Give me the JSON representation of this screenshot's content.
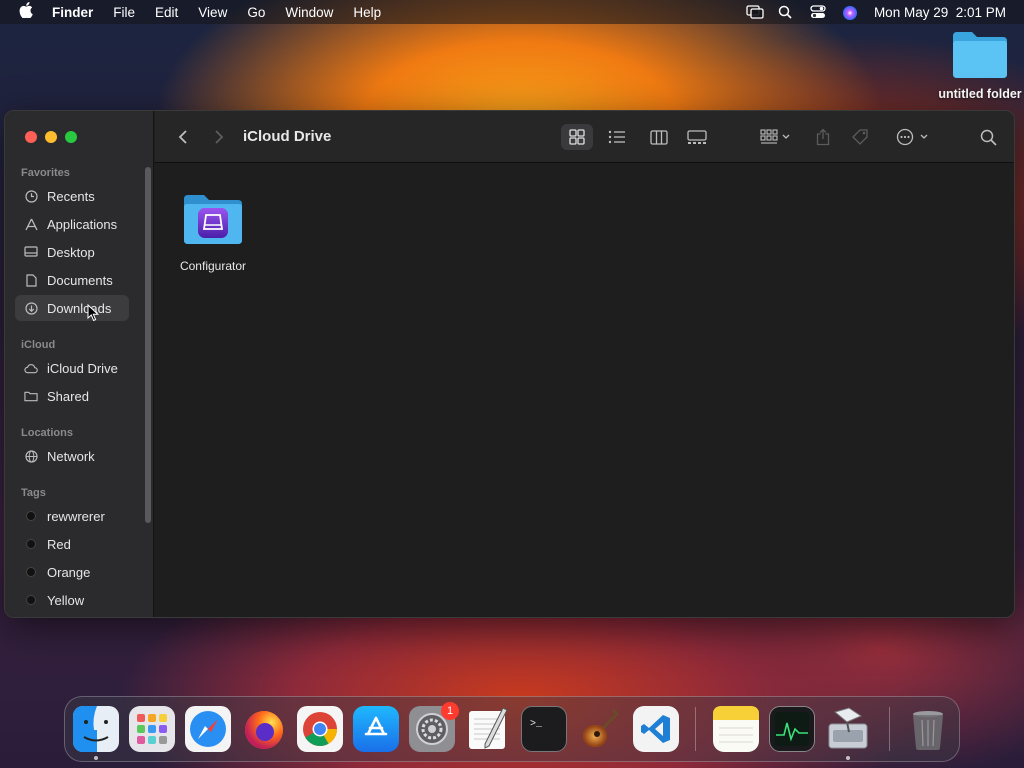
{
  "menubar": {
    "app_name": "Finder",
    "menus": [
      "File",
      "Edit",
      "View",
      "Go",
      "Window",
      "Help"
    ],
    "clock": "Mon May 29  2:01 PM"
  },
  "desktop": {
    "folder_label": "untitled folder"
  },
  "window": {
    "title": "iCloud Drive",
    "sidebar": {
      "favorites_header": "Favorites",
      "favorites": [
        "Recents",
        "Applications",
        "Desktop",
        "Documents",
        "Downloads"
      ],
      "icloud_header": "iCloud",
      "icloud": [
        "iCloud Drive",
        "Shared"
      ],
      "locations_header": "Locations",
      "locations": [
        "Network"
      ],
      "tags_header": "Tags",
      "tags": [
        "rewwrerer",
        "Red",
        "Orange",
        "Yellow"
      ],
      "selected": "Downloads"
    },
    "items": [
      {
        "name": "Configurator"
      }
    ]
  },
  "dock": {
    "apps": [
      "Finder",
      "Launchpad",
      "Safari",
      "Firefox",
      "Chrome",
      "App Store",
      "System Settings",
      "TextEdit",
      "Terminal",
      "GarageBand",
      "Visual Studio Code",
      "Notes",
      "Activity Monitor",
      "Disk Utility",
      "Trash"
    ],
    "settings_badge": "1"
  },
  "colors": {
    "accent_folder": "#4fb6f0",
    "selection": "#3c3c3f",
    "badge": "#ff3b30"
  }
}
